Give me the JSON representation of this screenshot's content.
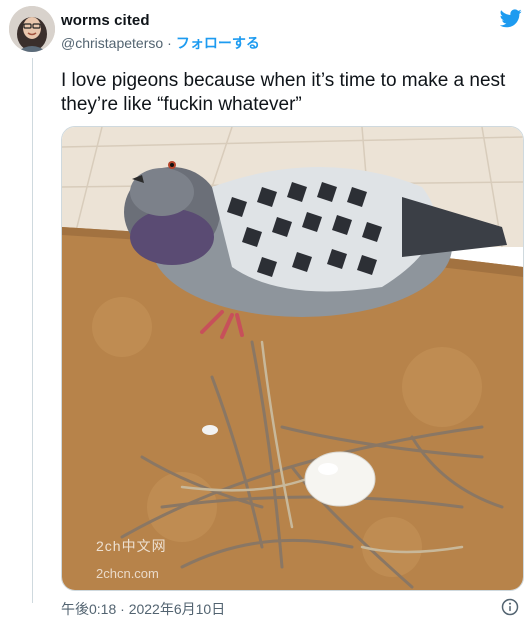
{
  "author": {
    "display_name": "worms cited",
    "handle": "@christapeterso",
    "follow_label": "フォローする"
  },
  "tweet": {
    "text_line1": "I love pigeons because when it’s time to make a nest",
    "text_line2": "they’re like “fuckin whatever”",
    "timestamp": "午後0:18 · 2022年6月10日"
  },
  "watermark": {
    "line1": "2ch中文网",
    "line2": "2chcn.com"
  },
  "colors": {
    "link": "#1d9bf0",
    "secondary_text": "#536471",
    "border": "#cfd9de"
  },
  "icons": [
    "twitter-bird-icon",
    "info-icon"
  ]
}
